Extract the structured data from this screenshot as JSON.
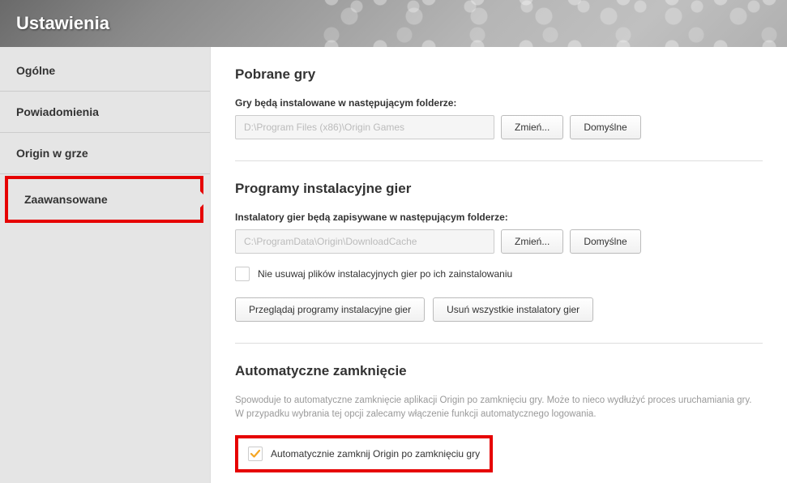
{
  "header": {
    "title": "Ustawienia"
  },
  "sidebar": {
    "tabs": [
      {
        "label": "Ogólne"
      },
      {
        "label": "Powiadomienia"
      },
      {
        "label": "Origin w grze"
      },
      {
        "label": "Zaawansowane"
      }
    ]
  },
  "sections": {
    "downloads": {
      "title": "Pobrane gry",
      "label": "Gry będą instalowane w następującym folderze:",
      "path": "D:\\Program Files (x86)\\Origin Games",
      "change": "Zmień...",
      "default": "Domyślne"
    },
    "installers": {
      "title": "Programy instalacyjne gier",
      "label": "Instalatory gier będą zapisywane w następującym folderze:",
      "path": "C:\\ProgramData\\Origin\\DownloadCache",
      "change": "Zmień...",
      "default": "Domyślne",
      "keep_checkbox": "Nie usuwaj plików instalacyjnych gier po ich zainstalowaniu",
      "browse": "Przeglądaj programy instalacyjne gier",
      "deleteAll": "Usuń wszystkie instalatory gier"
    },
    "autoclose": {
      "title": "Automatyczne zamknięcie",
      "description": "Spowoduje to automatyczne zamknięcie aplikacji Origin po zamknięciu gry. Może to nieco wydłużyć proces uruchamiania gry. W przypadku wybrania tej opcji zalecamy włączenie funkcji automatycznego logowania.",
      "checkbox": "Automatycznie zamknij Origin po zamknięciu gry"
    }
  }
}
